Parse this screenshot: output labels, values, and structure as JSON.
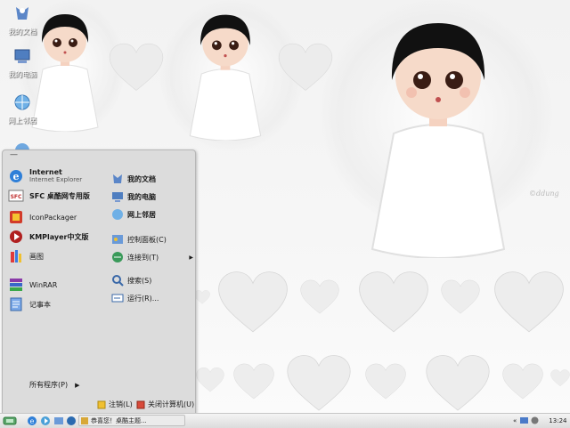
{
  "desktop": {
    "icons": [
      {
        "label": "我的文档",
        "name": "my-documents"
      },
      {
        "label": "我的电脑",
        "name": "my-computer"
      },
      {
        "label": "网上邻居",
        "name": "network-places"
      }
    ],
    "watermark": "©ddung"
  },
  "start_menu": {
    "user_name": "—",
    "pinned": [
      {
        "title": "Internet",
        "subtitle": "Internet Explorer",
        "icon": "ie-icon"
      },
      {
        "title": "SFC 桌酷网专用版",
        "subtitle": "",
        "icon": "sfc-icon"
      }
    ],
    "recent": [
      {
        "label": "IconPackager",
        "icon": "iconpackager-icon"
      },
      {
        "label": "KMPlayer中文版",
        "icon": "kmplayer-icon"
      },
      {
        "label": "画图",
        "icon": "paint-icon"
      },
      {
        "label": "WinRAR",
        "icon": "winrar-icon"
      },
      {
        "label": "记事本",
        "icon": "notepad-icon"
      }
    ],
    "places": [
      {
        "label": "我的文档",
        "icon": "documents-icon",
        "bold": true
      },
      {
        "label": "我的电脑",
        "icon": "computer-icon",
        "bold": true
      },
      {
        "label": "网上邻居",
        "icon": "network-icon",
        "bold": true
      },
      {
        "label": "控制面板(C)",
        "icon": "control-panel-icon",
        "bold": false
      },
      {
        "label": "连接到(T)",
        "icon": "connect-icon",
        "bold": false,
        "submenu": "▶"
      },
      {
        "label": "搜索(S)",
        "icon": "search-icon",
        "bold": false
      },
      {
        "label": "运行(R)...",
        "icon": "run-icon",
        "bold": false
      }
    ],
    "all_programs": "所有程序(P)",
    "all_programs_arrow": "▶",
    "logoff": "注销(L)",
    "shutdown": "关闭计算机(U)"
  },
  "taskbar": {
    "task_label": "恭喜您！桌酷主题...",
    "clock": "13:24",
    "tray_arrow": "«"
  },
  "colors": {
    "menu_bg": "#dcdcdc",
    "taskbar_bg": "#e8e8e8",
    "wallpaper_bg": "#f3f3f3"
  }
}
